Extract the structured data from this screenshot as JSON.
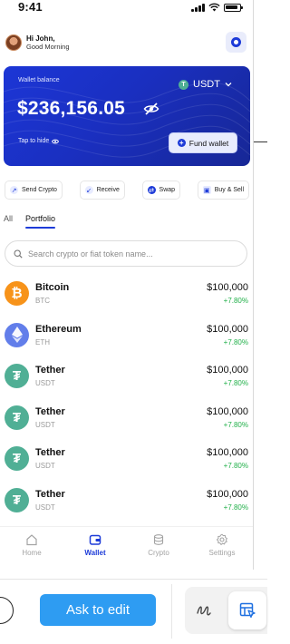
{
  "status_bar": {
    "time": "9:41"
  },
  "header": {
    "greeting": "Hi John,",
    "subgreeting": "Good Morning"
  },
  "wallet": {
    "label": "Wallet balance",
    "amount": "$236,156.05",
    "currency": "USDT",
    "tap_hint": "Tap to hide",
    "fund_label": "Fund wallet"
  },
  "actions": [
    {
      "label": "Send Crypto",
      "icon": "send-arrow-icon"
    },
    {
      "label": "Receive",
      "icon": "receive-arrow-icon"
    },
    {
      "label": "Swap",
      "icon": "swap-icon"
    },
    {
      "label": "Buy & Sell",
      "icon": "buy-sell-icon"
    }
  ],
  "tabs": {
    "all": "All",
    "portfolio": "Portfolio"
  },
  "search": {
    "placeholder": "Search crypto or fiat token name..."
  },
  "assets": [
    {
      "name": "Bitcoin",
      "symbol": "BTC",
      "value": "$100,000",
      "change": "+7.80%",
      "color": "#f7931a"
    },
    {
      "name": "Ethereum",
      "symbol": "ETH",
      "value": "$100,000",
      "change": "+7.80%",
      "color": "#627eea"
    },
    {
      "name": "Tether",
      "symbol": "USDT",
      "value": "$100,000",
      "change": "+7.80%",
      "color": "#50af95"
    },
    {
      "name": "Tether",
      "symbol": "USDT",
      "value": "$100,000",
      "change": "+7.80%",
      "color": "#50af95"
    },
    {
      "name": "Tether",
      "symbol": "USDT",
      "value": "$100,000",
      "change": "+7.80%",
      "color": "#50af95"
    },
    {
      "name": "Tether",
      "symbol": "USDT",
      "value": "$100,000",
      "change": "+7.80%",
      "color": "#50af95"
    }
  ],
  "nav": [
    {
      "label": "Home",
      "icon": "home-icon",
      "active": false
    },
    {
      "label": "Wallet",
      "icon": "wallet-icon",
      "active": true
    },
    {
      "label": "Crypto",
      "icon": "crypto-icon",
      "active": false
    },
    {
      "label": "Settings",
      "icon": "gear-icon",
      "active": false
    }
  ],
  "toolbar": {
    "ask_label": "Ask to edit"
  },
  "colors": {
    "brand_blue": "#1d3bd8",
    "positive": "#22b04a",
    "ask_button": "#2e9cf2"
  }
}
